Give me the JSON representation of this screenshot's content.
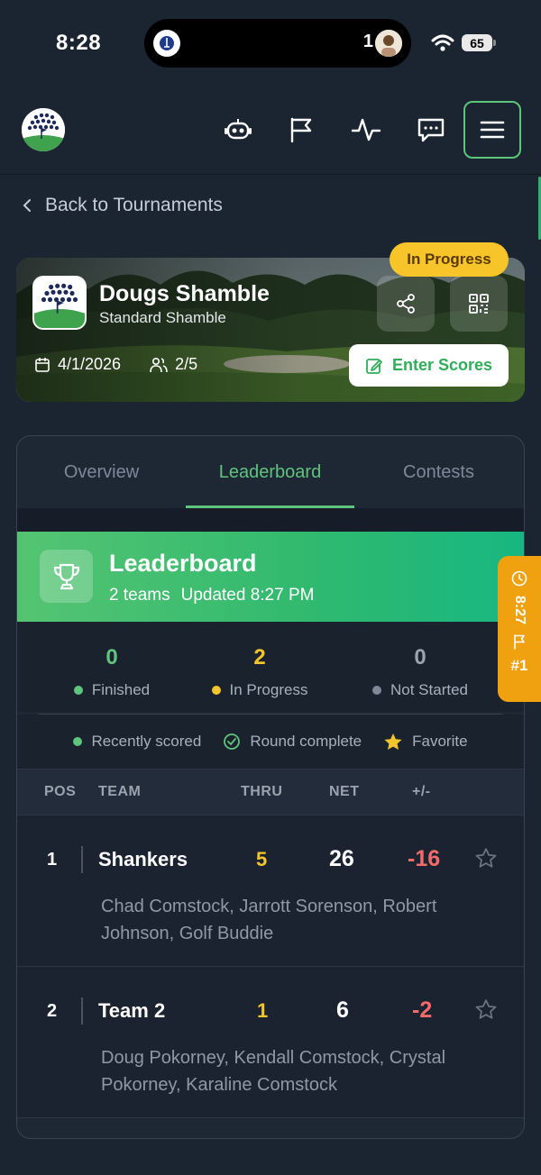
{
  "status_bar": {
    "time": "8:28",
    "notification_count": "1",
    "battery": "65"
  },
  "header": {
    "icons": [
      "bot-icon",
      "flag-icon",
      "activity-icon",
      "chat-icon",
      "menu-icon"
    ],
    "accent": "#5cc578"
  },
  "back_link": "Back to Tournaments",
  "tournament": {
    "name": "Dougs Shamble",
    "format": "Standard Shamble",
    "date": "4/1/2026",
    "players": "2/5",
    "status": "In Progress",
    "enter_scores": "Enter Scores"
  },
  "tabs": [
    "Overview",
    "Leaderboard",
    "Contests"
  ],
  "active_tab": "Leaderboard",
  "leaderboard": {
    "title": "Leaderboard",
    "team_count": "2 teams",
    "updated": "Updated 8:27 PM",
    "stats": [
      {
        "value": "0",
        "label": "Finished",
        "color": "#5fc47c"
      },
      {
        "value": "2",
        "label": "In Progress",
        "color": "#f3c52c"
      },
      {
        "value": "0",
        "label": "Not Started",
        "color": "#9aa3ae"
      }
    ],
    "legend": [
      "Recently scored",
      "Round complete",
      "Favorite"
    ],
    "columns": [
      "POS",
      "TEAM",
      "THRU",
      "NET",
      "+/-"
    ],
    "rows": [
      {
        "pos": "1",
        "team": "Shankers",
        "thru": "5",
        "net": "26",
        "pm": "-16",
        "players": "Chad Comstock, Jarrott Sorenson, Robert Johnson, Golf Buddie"
      },
      {
        "pos": "2",
        "team": "Team 2",
        "thru": "1",
        "net": "6",
        "pm": "-2",
        "players": "Doug Pokorney, Kendall Comstock, Crystal Pokorney, Karaline Comstock"
      }
    ]
  },
  "side_tab": {
    "time": "8:27",
    "rank": "#1"
  }
}
